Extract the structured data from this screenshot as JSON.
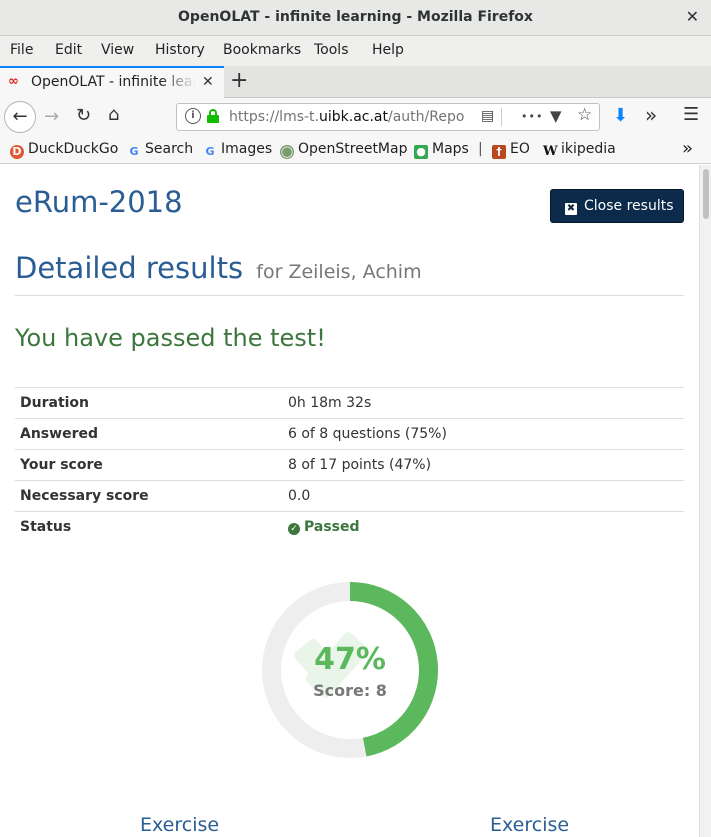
{
  "window": {
    "title": "OpenOLAT - infinite learning - Mozilla Firefox",
    "close_glyph": "✕"
  },
  "menu": [
    "File",
    "Edit",
    "View",
    "History",
    "Bookmarks",
    "Tools",
    "Help"
  ],
  "tab": {
    "label": "OpenOLAT - infinite learning - Mozilla Firefox",
    "favicon": "∞",
    "close_glyph": "✕"
  },
  "newtab_glyph": "+",
  "nav": {
    "url_prefix": "https://lms-t.",
    "url_host": "uibk.ac.at",
    "url_suffix": "/auth/Repo",
    "more_glyph": "•••"
  },
  "bookmarks": [
    {
      "label": "DuckDuckGo",
      "icon": "duckduckgo-icon"
    },
    {
      "label": "Search",
      "icon": "google-icon"
    },
    {
      "label": "Images",
      "icon": "google-icon"
    },
    {
      "label": "OpenStreetMap",
      "icon": "openstreetmap-icon"
    },
    {
      "label": "Maps",
      "icon": "maps-icon"
    },
    {
      "label": "|",
      "icon": ""
    },
    {
      "label": "EO",
      "icon": "eo-icon"
    },
    {
      "label": "ikipedia",
      "icon": "wikipedia-icon"
    }
  ],
  "page": {
    "course_title": "eRum-2018",
    "close_results": "Close results",
    "heading": "Detailed results",
    "heading_for": "for Zeileis, Achim",
    "passed_message": "You have passed the test!",
    "rows": [
      {
        "key": "Duration",
        "value": "0h 18m 32s"
      },
      {
        "key": "Answered",
        "value": "6 of 8 questions (75%)"
      },
      {
        "key": "Your score",
        "value": "8 of 17 points (47%)"
      },
      {
        "key": "Necessary score",
        "value": "0.0"
      },
      {
        "key": "Status",
        "value": "Passed"
      }
    ],
    "donut": {
      "percent_label": "47%",
      "percent_value": 47,
      "score_label": "Score: 8",
      "fill_color": "#5cb85c",
      "track_color": "#eeeeee"
    },
    "exercises": [
      "Exercise",
      "Exercise"
    ]
  }
}
